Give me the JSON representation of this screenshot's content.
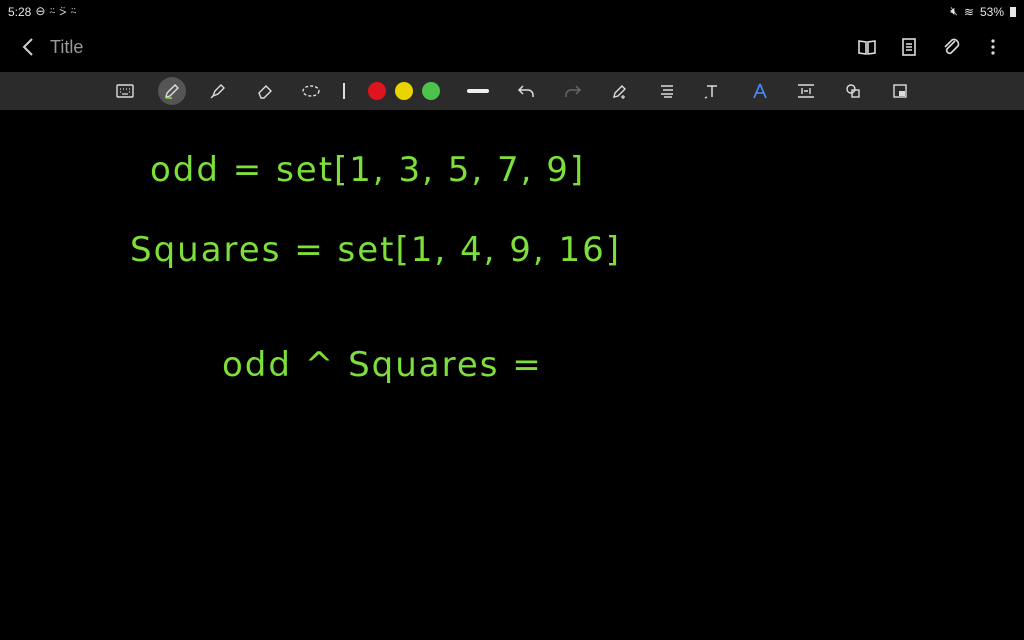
{
  "status_bar": {
    "time": "5:28",
    "battery": "53%"
  },
  "header": {
    "title": "Title",
    "icons": [
      "book-icon",
      "page-icon",
      "attach-icon",
      "more-icon"
    ]
  },
  "toolbar": {
    "tools": [
      "keyboard",
      "pen",
      "highlighter",
      "eraser",
      "lasso",
      "divider",
      "color-red",
      "color-yellow",
      "color-green",
      "line-weight",
      "undo",
      "redo",
      "pen-settings",
      "text-align",
      "text-tool",
      "shape-recognition",
      "insert-space",
      "shapes",
      "read-only"
    ],
    "colors": [
      "#e0141e",
      "#e8d400",
      "#4cc44c"
    ]
  },
  "canvas": {
    "ink_color": "#7cdf3a",
    "lines": [
      "odd = set[1, 3, 5, 7, 9]",
      "Squares = set[1, 4, 9, 16]",
      "odd ^ Squares ="
    ]
  }
}
